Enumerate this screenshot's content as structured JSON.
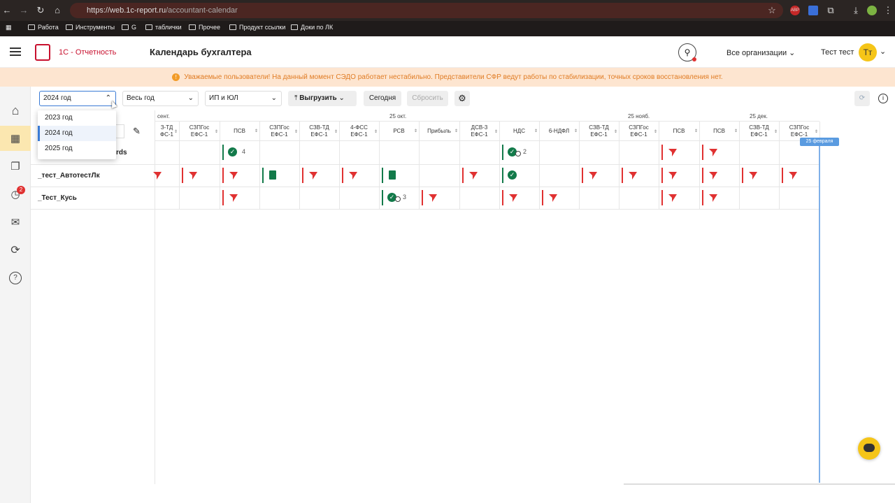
{
  "browser": {
    "url_host": "https://web.1c-report.ru",
    "url_path": "/accountant-calendar"
  },
  "bookmarks": [
    "Работа",
    "Инструменты",
    "G",
    "таблички",
    "Прочее",
    "Продукт ссылки",
    "Доки по ЛК"
  ],
  "header": {
    "brand": "1С - Отчетность",
    "title": "Календарь бухгалтера",
    "org_selector": "Все организации",
    "user_name": "Тест тест",
    "user_initials": "Тт"
  },
  "banner": {
    "text": "Уважаемые пользователи! На данный момент СЭДО работает нестабильно. Представители СФР ведут работы по стабилизации, точных сроков восстановления нет."
  },
  "sidebar": {
    "badge_count": "2"
  },
  "toolbar": {
    "year": "2024 год",
    "period": "Весь год",
    "org_type": "ИП и ЮЛ",
    "export": "Выгрузить",
    "today": "Сегодня",
    "reset": "Сбросить"
  },
  "year_dropdown": {
    "options": [
      "2023 год",
      "2024 год",
      "2025 год"
    ],
    "selected": "2024 год"
  },
  "timeline": {
    "months": [
      "сент.",
      "25 окт.",
      "25 нояб.",
      "25 дек."
    ],
    "today_marker": "25 февраля"
  },
  "columns": [
    {
      "l1": "З-ТД",
      "l2": "ФС-1"
    },
    {
      "l1": "СЗПГос",
      "l2": "ЕФС-1"
    },
    {
      "l1": "ПСВ",
      "l2": ""
    },
    {
      "l1": "СЗПГос",
      "l2": "ЕФС-1"
    },
    {
      "l1": "СЗВ-ТД",
      "l2": "ЕФС-1"
    },
    {
      "l1": "4-ФСС",
      "l2": "ЕФС-1"
    },
    {
      "l1": "РСВ",
      "l2": ""
    },
    {
      "l1": "Прибыль",
      "l2": ""
    },
    {
      "l1": "ДСВ-3",
      "l2": "ЕФС-1"
    },
    {
      "l1": "НДС",
      "l2": ""
    },
    {
      "l1": "6-НДФЛ",
      "l2": ""
    },
    {
      "l1": "СЗВ-ТД",
      "l2": "ЕФС-1"
    },
    {
      "l1": "СЗПГос",
      "l2": "ЕФС-1"
    },
    {
      "l1": "ПСВ",
      "l2": ""
    },
    {
      "l1": "ПСВ",
      "l2": ""
    },
    {
      "l1": "СЗВ-ТД",
      "l2": "ЕФС-1"
    },
    {
      "l1": "СЗПГос",
      "l2": "ЕФС-1"
    }
  ],
  "orgs": [
    {
      "name": "rds"
    },
    {
      "name": "_тест_АвтотестЛк"
    },
    {
      "name": "_Тест_Кусь"
    }
  ],
  "counts": {
    "r1_psv": "4",
    "r1_nds": "2",
    "r3_rsv": "3"
  },
  "colors": {
    "accent": "#e03131",
    "brand": "#c8102e",
    "ok": "#127a4a",
    "banner_bg": "#fde5d0",
    "avatar": "#f5c518"
  }
}
